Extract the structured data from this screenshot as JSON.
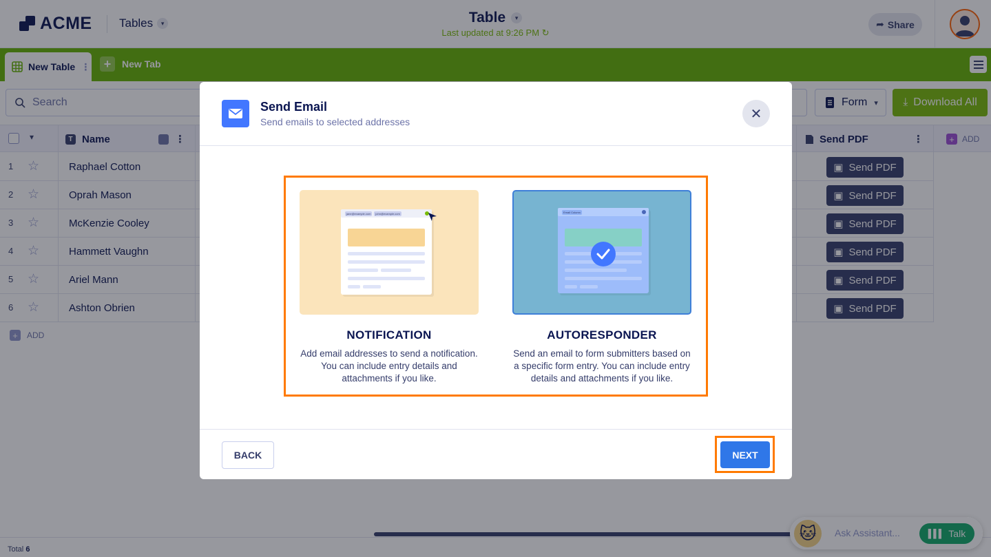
{
  "header": {
    "brand": "ACME",
    "section_label": "Tables",
    "title": "Table",
    "updated": "Last updated at 9:26 PM",
    "share_label": "Share"
  },
  "tabs": {
    "active_label": "New Table",
    "new_tab_label": "New Tab"
  },
  "toolbar": {
    "search_placeholder": "Search",
    "form_label": "Form",
    "download_label": "Download All"
  },
  "table": {
    "columns": {
      "name": "Name",
      "send_pdf": "Send PDF",
      "add": "ADD"
    },
    "rows": [
      {
        "num": "1",
        "name": "Raphael Cotton",
        "button": "Send PDF"
      },
      {
        "num": "2",
        "name": "Oprah Mason",
        "button": "Send PDF"
      },
      {
        "num": "3",
        "name": "McKenzie Cooley",
        "button": "Send PDF"
      },
      {
        "num": "4",
        "name": "Hammett Vaughn",
        "button": "Send PDF"
      },
      {
        "num": "5",
        "name": "Ariel Mann",
        "button": "Send PDF"
      },
      {
        "num": "6",
        "name": "Ashton Obrien",
        "button": "Send PDF"
      }
    ],
    "add_row_label": "ADD",
    "total_label": "Total",
    "total_count": "6"
  },
  "modal": {
    "title": "Send Email",
    "subtitle": "Send emails to selected addresses",
    "options": [
      {
        "title": "NOTIFICATION",
        "description": "Add email addresses to send a notification. You can include entry details and attachments if you like.",
        "chip_1": "jane@example.com",
        "chip_2": "john@example.com"
      },
      {
        "title": "AUTORESPONDER",
        "description": "Send an email to form submitters based on a specific form entry. You can include entry details and attachments if you like.",
        "chip_1": "Email Column"
      }
    ],
    "back_label": "BACK",
    "next_label": "NEXT"
  },
  "assistant": {
    "placeholder": "Ask Assistant...",
    "talk_label": "Talk"
  },
  "colors": {
    "brand_green": "#64b200",
    "highlight_orange": "#ff7a00",
    "primary_blue": "#2f77e8",
    "navy": "#0a1551"
  }
}
